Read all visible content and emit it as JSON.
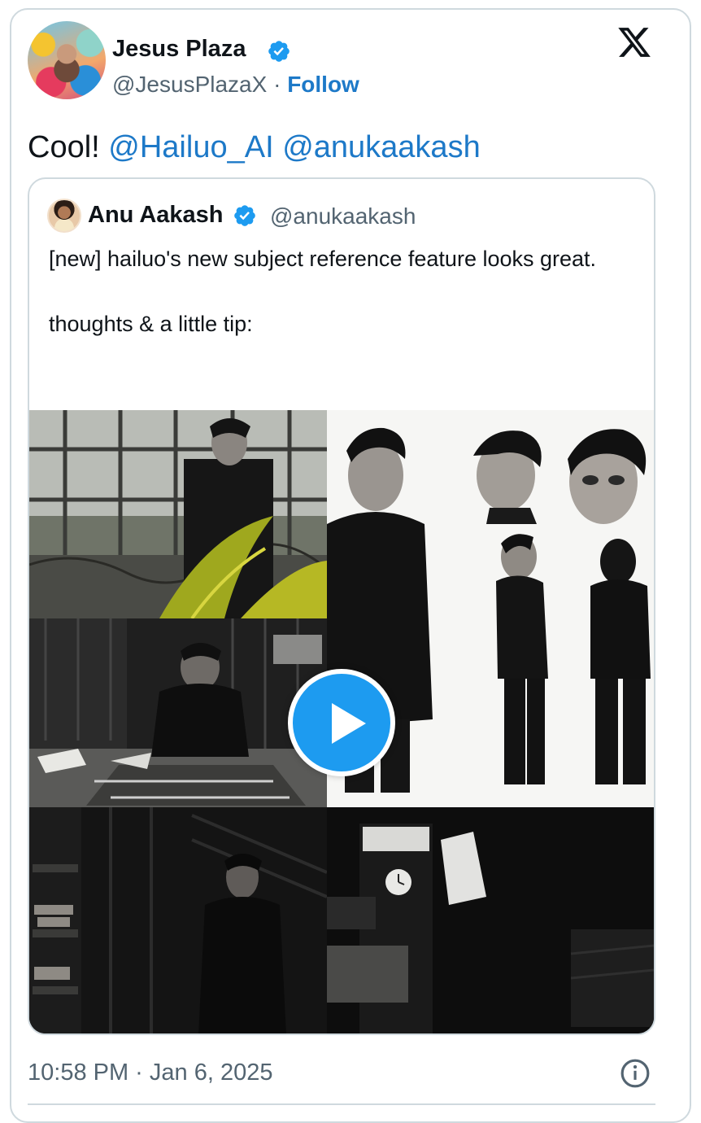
{
  "tweet": {
    "author": {
      "name": "Jesus Plaza",
      "handle": "@JesusPlazaX",
      "separator": "·",
      "follow_label": "Follow",
      "verified_icon": "verified-badge-icon"
    },
    "text_prefix": "Cool! ",
    "mentions": [
      "@Hailuo_AI",
      "@anukaakash"
    ],
    "logo_icon": "x-logo-icon",
    "timestamp": "10:58 PM · Jan 6, 2025",
    "info_icon": "info-icon"
  },
  "quoted_tweet": {
    "author": {
      "name": "Anu Aakash",
      "handle": "@anukaakash",
      "verified_icon": "verified-badge-icon"
    },
    "paragraphs": [
      "[new] hailuo's new subject reference feature looks great.",
      "thoughts & a little tip:"
    ],
    "media": {
      "tiles": [
        "greenhouse-still",
        "character-reference-sheet",
        "kneeling-figure-still",
        "staircase-figure-still",
        "clock-room-still"
      ],
      "play_icon": "play-icon"
    }
  },
  "colors": {
    "link": "#1d79c8",
    "verified": "#1d9bf0",
    "secondary_text": "#536471",
    "border": "#cfd9de"
  }
}
